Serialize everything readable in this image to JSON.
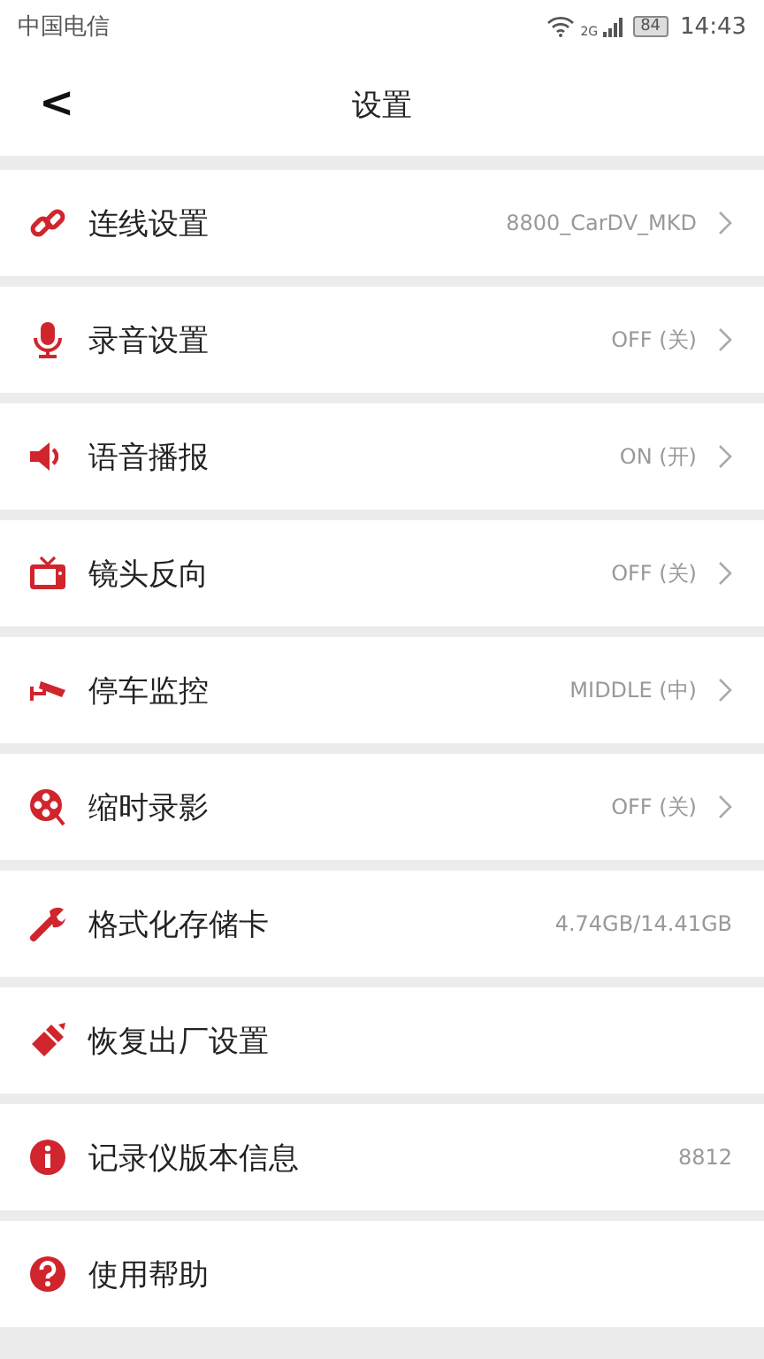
{
  "status_bar": {
    "carrier": "中国电信",
    "network": "2G",
    "battery": "84",
    "time": "14:43"
  },
  "header": {
    "back": "<",
    "title": "设置"
  },
  "items": [
    {
      "kind": "link",
      "label": "连线设置",
      "value": "8800_CarDV_MKD",
      "chevron": true
    },
    {
      "kind": "mic",
      "label": "录音设置",
      "value": "OFF (关)",
      "chevron": true
    },
    {
      "kind": "speaker",
      "label": "语音播报",
      "value": "ON (开)",
      "chevron": true
    },
    {
      "kind": "tv",
      "label": "镜头反向",
      "value": "OFF (关)",
      "chevron": true
    },
    {
      "kind": "camera",
      "label": "停车监控",
      "value": "MIDDLE (中)",
      "chevron": true
    },
    {
      "kind": "reel",
      "label": "缩时录影",
      "value": "OFF (关)",
      "chevron": true
    },
    {
      "kind": "wrench",
      "label": "格式化存储卡",
      "value": "4.74GB/14.41GB",
      "chevron": false
    },
    {
      "kind": "brush",
      "label": "恢复出厂设置",
      "chevron": false
    },
    {
      "kind": "info",
      "label": "记录仪版本信息",
      "value": "8812",
      "chevron": false
    },
    {
      "kind": "help",
      "label": "使用帮助",
      "chevron": false
    }
  ]
}
